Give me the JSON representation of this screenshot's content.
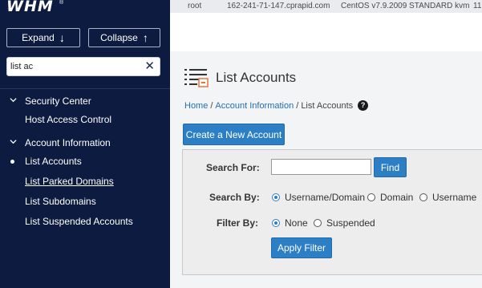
{
  "sidebar": {
    "logo": "WHM",
    "logo_mark": "®",
    "expand_label": "Expand",
    "collapse_label": "Collapse",
    "search_value": "list ac",
    "categories": [
      {
        "label": "Security Center",
        "items": [
          {
            "label": "Host Access Control"
          }
        ]
      },
      {
        "label": "Account Information",
        "items": [
          {
            "label": "List Accounts",
            "active": true
          },
          {
            "label": "List Parked Domains",
            "hover": true
          },
          {
            "label": "List Subdomains"
          },
          {
            "label": "List Suspended Accounts"
          }
        ]
      }
    ]
  },
  "topbar": {
    "user": "root",
    "hostname": "162-241-71-147.cprapid.com",
    "os": "CentOS v7.9.2009 STANDARD kvm",
    "version": "11"
  },
  "page": {
    "title": "List Accounts",
    "breadcrumb": [
      "Home",
      "Account Information",
      "List Accounts"
    ],
    "breadcrumb_sep": "/",
    "help": "?",
    "create_button": "Create a New Account"
  },
  "search_form": {
    "search_for_label": "Search For:",
    "search_value": "",
    "find_button": "Find",
    "search_by_label": "Search By:",
    "search_by_options": [
      "Username/Domain",
      "Domain",
      "Username"
    ],
    "search_by_selected": "Username/Domain",
    "filter_by_label": "Filter By:",
    "filter_options": [
      "None",
      "Suspended"
    ],
    "filter_selected": "None",
    "apply_button": "Apply Filter"
  },
  "colors": {
    "sidebar_bg": "#0c1b3f",
    "accent": "#2c7fc4",
    "link": "#1d6fb5",
    "topbar_bg": "#e9ebee"
  }
}
